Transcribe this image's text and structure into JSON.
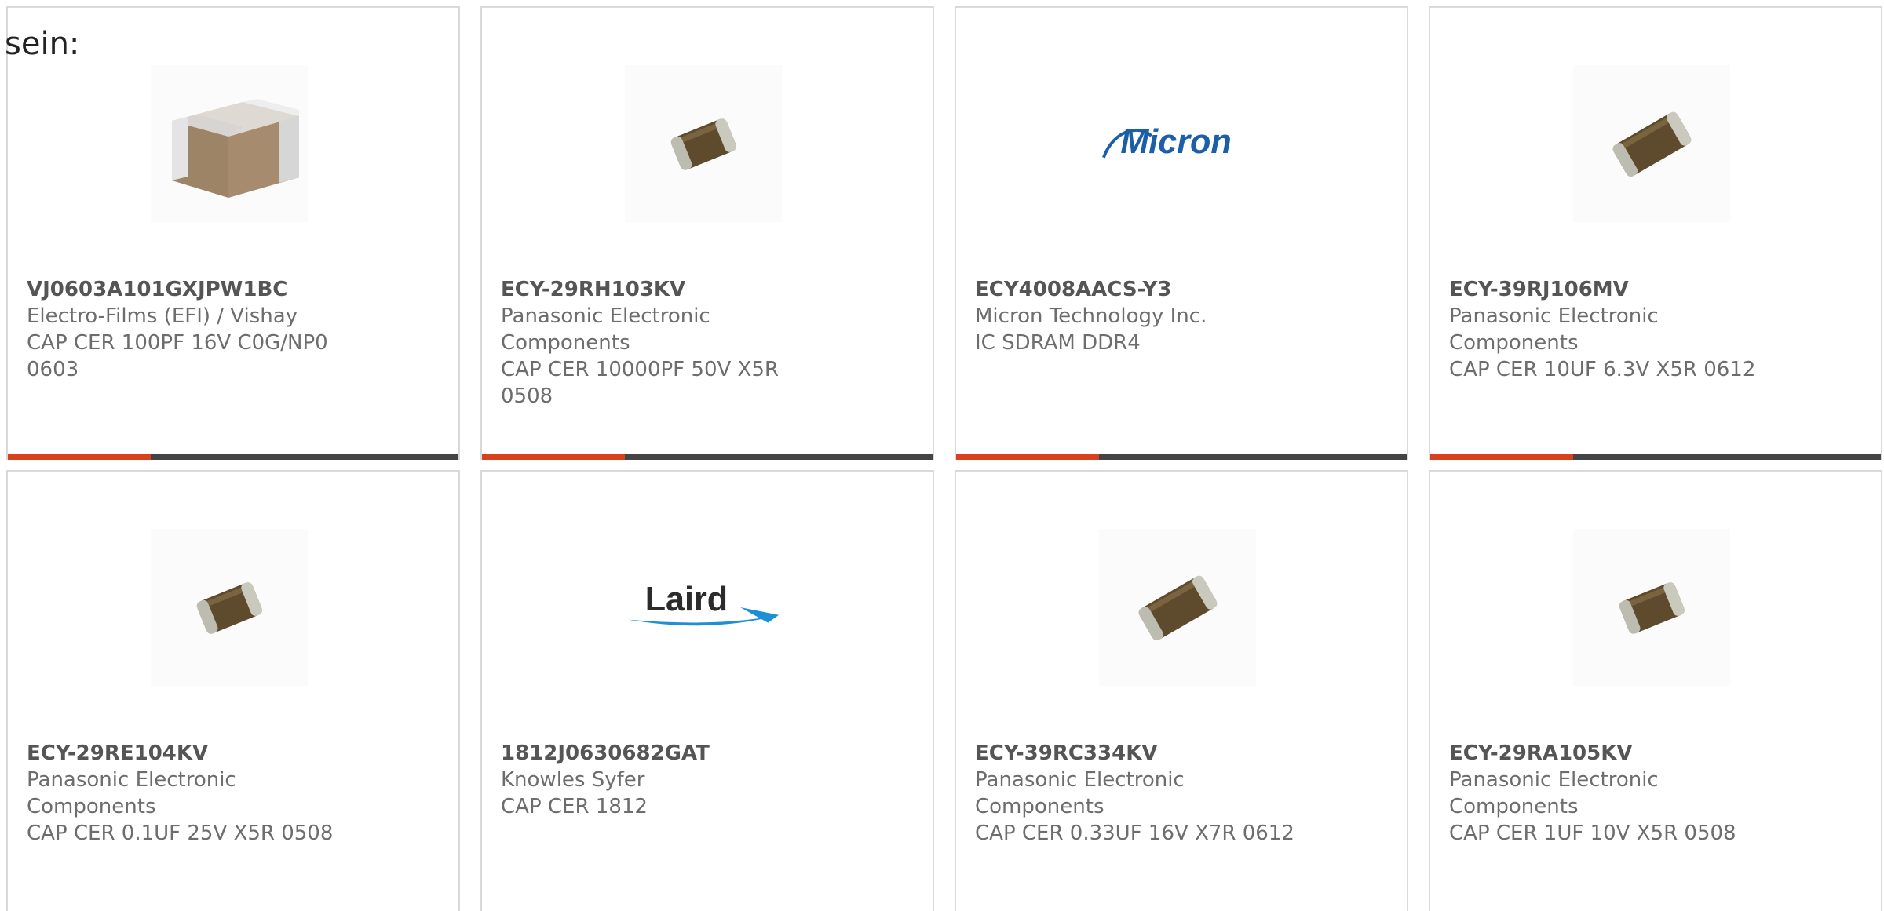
{
  "intro_text": "sein:",
  "colors": {
    "accent": "#d9411e",
    "bar": "#444444",
    "text": "#6d6d6d",
    "part_text": "#555555",
    "border": "#d9d9d9"
  },
  "products": [
    {
      "part": "VJ0603A101GXJPW1BC",
      "manufacturer": "Electro-Films (EFI) / Vishay",
      "description": "CAP CER 100PF 16V C0G/NP0 0603",
      "image": "large-ceramic-capacitor-image"
    },
    {
      "part": "ECY-29RH103KV",
      "manufacturer": "Panasonic Electronic Components",
      "description": "CAP CER 10000PF 50V X5R 0508",
      "image": "smd-chip-capacitor-image"
    },
    {
      "part": "ECY4008AACS-Y3",
      "manufacturer": "Micron Technology Inc.",
      "description": "IC SDRAM DDR4",
      "image": "micron-logo",
      "logo_text": "Micron"
    },
    {
      "part": "ECY-39RJ106MV",
      "manufacturer": "Panasonic Electronic Components",
      "description": "CAP CER 10UF 6.3V X5R 0612",
      "image": "smd-chip-capacitor-image"
    },
    {
      "part": "ECY-29RE104KV",
      "manufacturer": "Panasonic Electronic Components",
      "description": "CAP CER 0.1UF 25V X5R 0508",
      "image": "smd-chip-capacitor-image"
    },
    {
      "part": "1812J0630682GAT",
      "manufacturer": "Knowles Syfer",
      "description": "CAP CER 1812",
      "image": "laird-logo",
      "logo_text": "Laird"
    },
    {
      "part": "ECY-39RC334KV",
      "manufacturer": "Panasonic Electronic Components",
      "description": "CAP CER 0.33UF 16V X7R 0612",
      "image": "smd-chip-capacitor-image"
    },
    {
      "part": "ECY-29RA105KV",
      "manufacturer": "Panasonic Electronic Components",
      "description": "CAP CER 1UF 10V X5R 0508",
      "image": "smd-chip-capacitor-image"
    }
  ]
}
